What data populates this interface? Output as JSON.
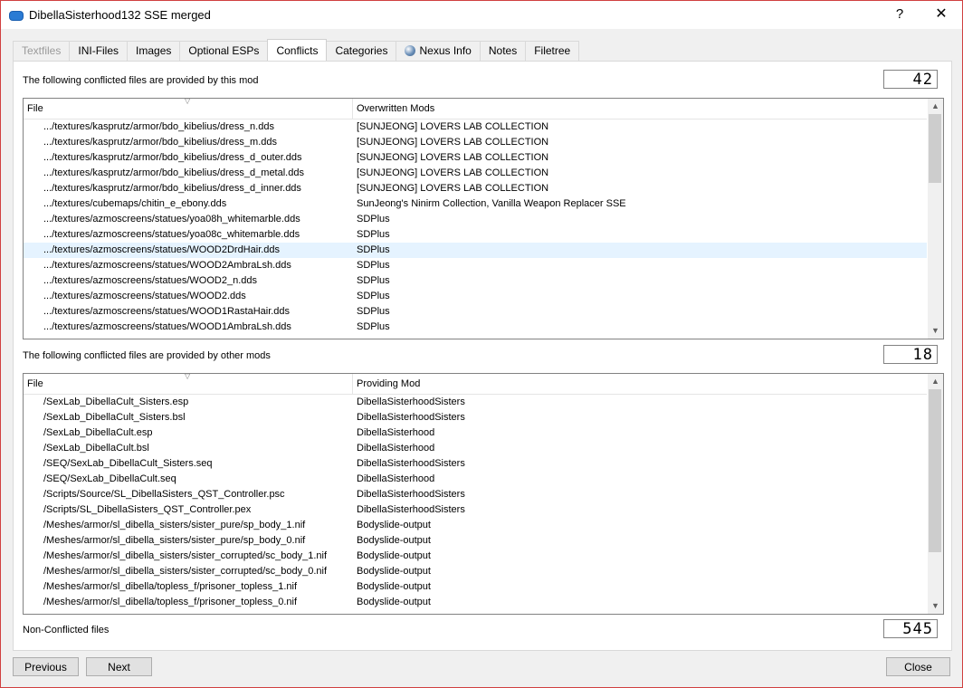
{
  "window": {
    "title": "DibellaSisterhood132 SSE merged",
    "help": "?",
    "close": "✕"
  },
  "tabs": [
    {
      "label": "Textfiles",
      "state": "disabled"
    },
    {
      "label": "INI-Files",
      "state": "normal"
    },
    {
      "label": "Images",
      "state": "normal"
    },
    {
      "label": "Optional ESPs",
      "state": "normal"
    },
    {
      "label": "Conflicts",
      "state": "active"
    },
    {
      "label": "Categories",
      "state": "normal"
    },
    {
      "label": "Nexus Info",
      "state": "normal",
      "icon": "globe-icon"
    },
    {
      "label": "Notes",
      "state": "normal"
    },
    {
      "label": "Filetree",
      "state": "normal"
    }
  ],
  "overwrite": {
    "label": "The following conflicted files are provided by this mod",
    "count": "42",
    "columns": [
      "File",
      "Overwritten Mods"
    ],
    "rows": [
      [
        ".../textures/kasprutz/armor/bdo_kibelius/dress_n.dds",
        "[SUNJEONG] LOVERS LAB COLLECTION"
      ],
      [
        ".../textures/kasprutz/armor/bdo_kibelius/dress_m.dds",
        "[SUNJEONG] LOVERS LAB COLLECTION"
      ],
      [
        ".../textures/kasprutz/armor/bdo_kibelius/dress_d_outer.dds",
        "[SUNJEONG] LOVERS LAB COLLECTION"
      ],
      [
        ".../textures/kasprutz/armor/bdo_kibelius/dress_d_metal.dds",
        "[SUNJEONG] LOVERS LAB COLLECTION"
      ],
      [
        ".../textures/kasprutz/armor/bdo_kibelius/dress_d_inner.dds",
        "[SUNJEONG] LOVERS LAB COLLECTION"
      ],
      [
        ".../textures/cubemaps/chitin_e_ebony.dds",
        "SunJeong's Ninirm Collection, Vanilla Weapon Replacer SSE"
      ],
      [
        ".../textures/azmoscreens/statues/yoa08h_whitemarble.dds",
        "SDPlus"
      ],
      [
        ".../textures/azmoscreens/statues/yoa08c_whitemarble.dds",
        "SDPlus"
      ],
      [
        ".../textures/azmoscreens/statues/WOOD2DrdHair.dds",
        "SDPlus"
      ],
      [
        ".../textures/azmoscreens/statues/WOOD2AmbraLsh.dds",
        "SDPlus"
      ],
      [
        ".../textures/azmoscreens/statues/WOOD2_n.dds",
        "SDPlus"
      ],
      [
        ".../textures/azmoscreens/statues/WOOD2.dds",
        "SDPlus"
      ],
      [
        ".../textures/azmoscreens/statues/WOOD1RastaHair.dds",
        "SDPlus"
      ],
      [
        ".../textures/azmoscreens/statues/WOOD1AmbraLsh.dds",
        "SDPlus"
      ]
    ],
    "selected_index": 8,
    "scroll_position": 0.0,
    "scroll_visible_fraction": 0.33
  },
  "overwritten": {
    "label": "The following conflicted files are provided by other mods",
    "count": "18",
    "columns": [
      "File",
      "Providing Mod"
    ],
    "rows": [
      [
        "/SexLab_DibellaCult_Sisters.esp",
        "DibellaSisterhoodSisters"
      ],
      [
        "/SexLab_DibellaCult_Sisters.bsl",
        "DibellaSisterhoodSisters"
      ],
      [
        "/SexLab_DibellaCult.esp",
        "DibellaSisterhood"
      ],
      [
        "/SexLab_DibellaCult.bsl",
        "DibellaSisterhood"
      ],
      [
        "/SEQ/SexLab_DibellaCult_Sisters.seq",
        "DibellaSisterhoodSisters"
      ],
      [
        "/SEQ/SexLab_DibellaCult.seq",
        "DibellaSisterhood"
      ],
      [
        "/Scripts/Source/SL_DibellaSisters_QST_Controller.psc",
        "DibellaSisterhoodSisters"
      ],
      [
        "/Scripts/SL_DibellaSisters_QST_Controller.pex",
        "DibellaSisterhoodSisters"
      ],
      [
        "/Meshes/armor/sl_dibella_sisters/sister_pure/sp_body_1.nif",
        "Bodyslide-output"
      ],
      [
        "/Meshes/armor/sl_dibella_sisters/sister_pure/sp_body_0.nif",
        "Bodyslide-output"
      ],
      [
        "/Meshes/armor/sl_dibella_sisters/sister_corrupted/sc_body_1.nif",
        "Bodyslide-output"
      ],
      [
        "/Meshes/armor/sl_dibella_sisters/sister_corrupted/sc_body_0.nif",
        "Bodyslide-output"
      ],
      [
        "/Meshes/armor/sl_dibella/topless_f/prisoner_topless_1.nif",
        "Bodyslide-output"
      ],
      [
        "/Meshes/armor/sl_dibella/topless_f/prisoner_topless_0.nif",
        "Bodyslide-output"
      ]
    ],
    "scroll_position": 0.0,
    "scroll_visible_fraction": 0.78
  },
  "nonconflicted": {
    "label": "Non-Conflicted files",
    "count": "545"
  },
  "buttons": {
    "previous": "Previous",
    "next": "Next",
    "close": "Close"
  }
}
